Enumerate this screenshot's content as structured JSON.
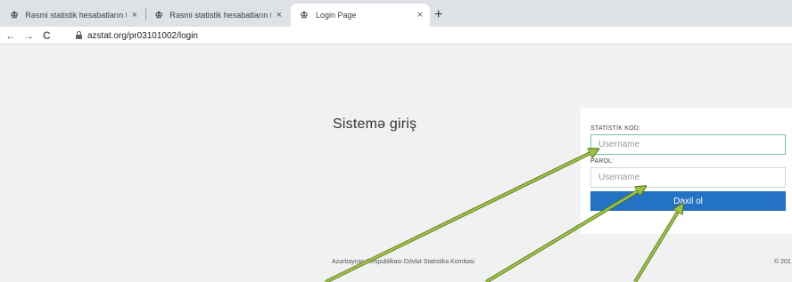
{
  "browser": {
    "tabs": [
      {
        "title": "Rəsmi statistik hesabatların təqd",
        "active": false
      },
      {
        "title": "Rəsmi statistik hesabatların təqd",
        "active": false
      },
      {
        "title": "Login Page",
        "active": true
      }
    ],
    "tab_close": "×",
    "new_tab": "+",
    "back": "←",
    "forward": "→",
    "reload": "C",
    "url": "azstat.org/pr03101002/login"
  },
  "page": {
    "heading": "Sistemə giriş",
    "code_label": "STATİSTİK KOD:",
    "code_placeholder": "Username",
    "password_label": "PAROL:",
    "password_placeholder": "Username",
    "login_button": "Daxil ol",
    "footer": "Azərbaycan Respublikası Dövlət Statistika Komitəsi",
    "copyright": "© 201"
  },
  "colors": {
    "button": "#2372c4",
    "arrow": "#9bc43c"
  }
}
